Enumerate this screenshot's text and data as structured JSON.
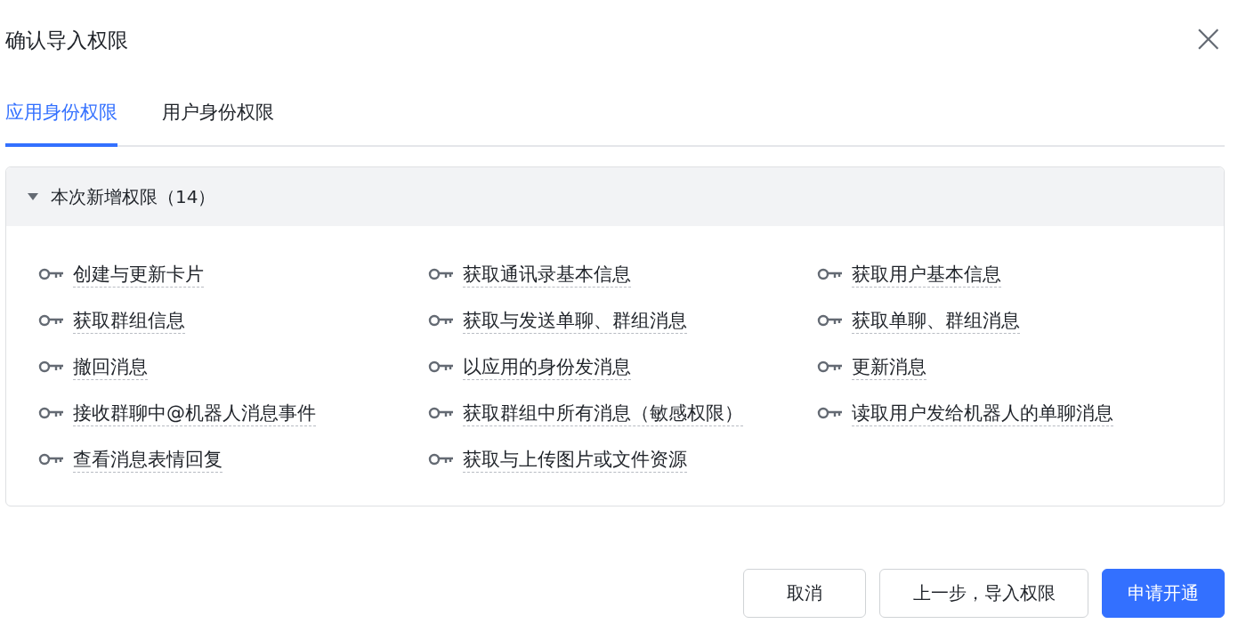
{
  "dialog": {
    "title": "确认导入权限",
    "close": "×"
  },
  "tabs": [
    {
      "label": "应用身份权限",
      "selected": true
    },
    {
      "label": "用户身份权限",
      "selected": false
    }
  ],
  "section": {
    "title": "本次新增权限（14）",
    "expanded": true,
    "permissions": [
      "创建与更新卡片",
      "获取通讯录基本信息",
      "获取用户基本信息",
      "获取群组信息",
      "获取与发送单聊、群组消息",
      "获取单聊、群组消息",
      "撤回消息",
      "以应用的身份发消息",
      "更新消息",
      "接收群聊中@机器人消息事件",
      "获取群组中所有消息（敏感权限）",
      "读取用户发给机器人的单聊消息",
      "查看消息表情回复",
      "获取与上传图片或文件资源"
    ]
  },
  "buttons": [
    {
      "label": "取消",
      "kind": "default"
    },
    {
      "label": "上一步，导入权限",
      "kind": "default"
    },
    {
      "label": "申请开通",
      "kind": "primary"
    }
  ]
}
